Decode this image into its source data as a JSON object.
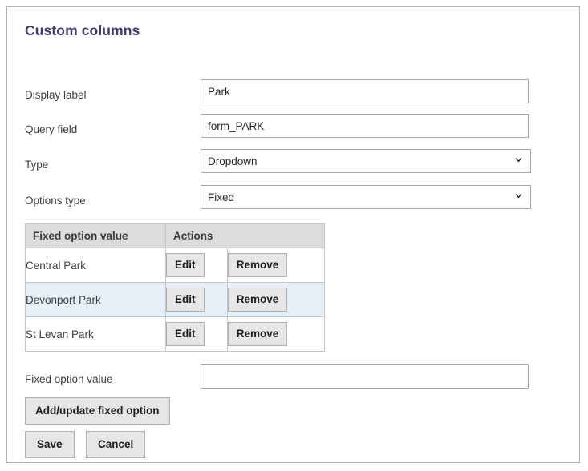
{
  "page": {
    "title": "Custom columns"
  },
  "form": {
    "fields": [
      {
        "label": "Display label",
        "value": "Park",
        "placeholder": "",
        "type": "text",
        "name": "display-label"
      },
      {
        "label": "Query field",
        "value": "form_PARK",
        "placeholder": "",
        "type": "text",
        "name": "query-field"
      },
      {
        "label": "Type",
        "value": "Dropdown",
        "type": "select",
        "name": "type",
        "options": [
          "Dropdown"
        ]
      },
      {
        "label": "Options type",
        "value": "Fixed",
        "type": "select",
        "name": "options-type",
        "options": [
          "Fixed"
        ]
      }
    ]
  },
  "options_table": {
    "headers": {
      "value": "Fixed option value",
      "actions": "Actions"
    },
    "rows": [
      {
        "value": "Central Park",
        "edit_label": "Edit",
        "remove_label": "Remove",
        "highlighted": false
      },
      {
        "value": "Devonport Park",
        "edit_label": "Edit",
        "remove_label": "Remove",
        "highlighted": true
      },
      {
        "value": "St Levan Park",
        "edit_label": "Edit",
        "remove_label": "Remove",
        "highlighted": false
      }
    ]
  },
  "new_option": {
    "label": "Fixed option value",
    "value": "",
    "placeholder": ""
  },
  "buttons": {
    "add_update": "Add/update fixed option",
    "save": "Save",
    "cancel": "Cancel"
  },
  "icons": {
    "chevron_down": "chevron-down-icon"
  },
  "colors": {
    "title": "#3f3d6b",
    "label_text": "#3c4043",
    "table_header_bg": "#dcdcdc",
    "row_highlight_bg": "#e7f0f9",
    "button_bg": "#e6e6e6",
    "border": "#b4b4b4"
  }
}
